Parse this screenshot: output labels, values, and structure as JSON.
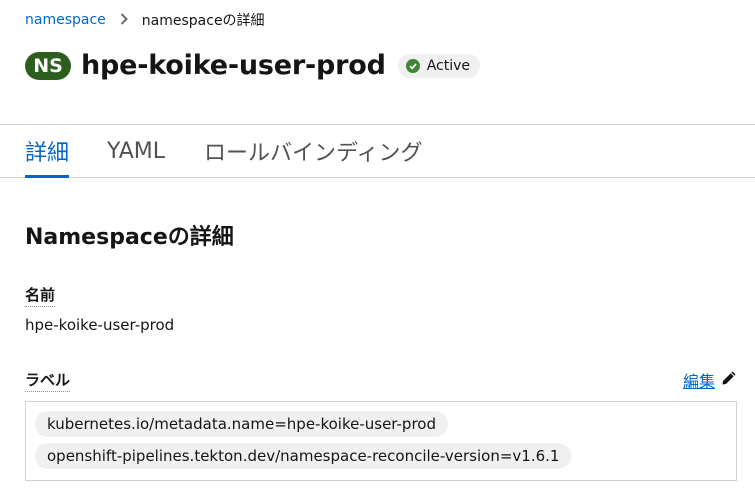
{
  "breadcrumb": {
    "parent": "namespace",
    "current": "namespaceの詳細"
  },
  "header": {
    "badge": "NS",
    "title": "hpe-koike-user-prod",
    "status": "Active"
  },
  "tabs": [
    {
      "label": "詳細",
      "active": true
    },
    {
      "label": "YAML",
      "active": false
    },
    {
      "label": "ロールバインディング",
      "active": false
    }
  ],
  "details": {
    "section_title": "Namespaceの詳細",
    "name_label": "名前",
    "name_value": "hpe-koike-user-prod",
    "labels_label": "ラベル",
    "edit_label": "編集",
    "labels": [
      "kubernetes.io/metadata.name=hpe-koike-user-prod",
      "openshift-pipelines.tekton.dev/namespace-reconcile-version=v1.6.1"
    ]
  },
  "icons": {
    "chevron": "chevron-right-icon",
    "status": "check-circle-icon",
    "edit": "pencil-icon"
  },
  "colors": {
    "link": "#0066cc",
    "ns_badge": "#2d5e1f",
    "status_ok": "#3e8635"
  }
}
